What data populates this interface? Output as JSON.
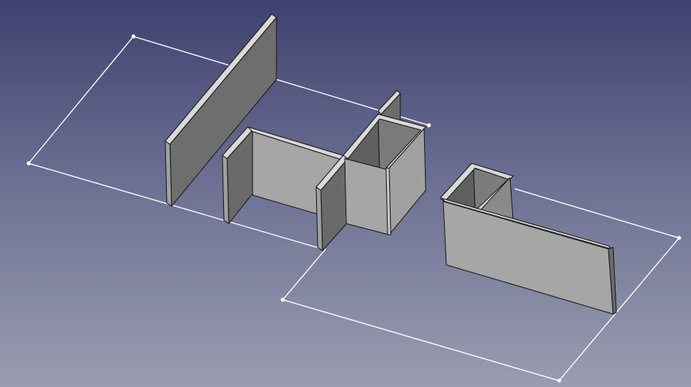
{
  "viewport": {
    "kind": "3d-view",
    "background_top": "#3f416f",
    "background_bottom": "#9a9cb0",
    "wireframe_color": "#ffffff",
    "face_light": "#a5a5a5",
    "face_dark": "#6b6b6b",
    "edge_color": "#1a1a1a"
  },
  "scene": {
    "objects": [
      "sketch-outline-left",
      "sketch-outline-right",
      "wall-panel-tall",
      "wall-u-channel",
      "wall-square-column",
      "wall-l-panel"
    ]
  }
}
